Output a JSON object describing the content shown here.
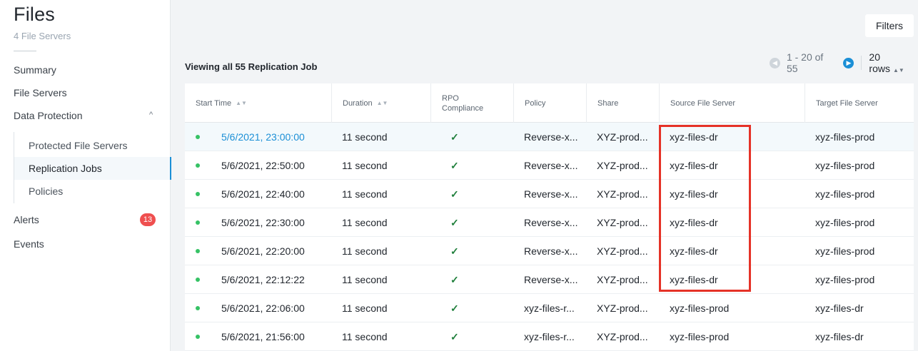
{
  "sidebar": {
    "title": "Files",
    "subtitle": "4 File Servers",
    "items": {
      "summary": "Summary",
      "file_servers": "File Servers",
      "data_protection": "Data Protection",
      "protected_file_servers": "Protected File Servers",
      "replication_jobs": "Replication Jobs",
      "policies": "Policies",
      "alerts": "Alerts",
      "alerts_count": "13",
      "events": "Events"
    }
  },
  "toolbar": {
    "filters_label": "Filters"
  },
  "list": {
    "viewing_text": "Viewing all 55 Replication Job"
  },
  "pagination": {
    "range": "1 - 20 of 55",
    "rows": "20 rows"
  },
  "columns": {
    "start_time": "Start Time",
    "duration": "Duration",
    "rpo_line1": "RPO",
    "rpo_line2": "Compliance",
    "policy": "Policy",
    "share": "Share",
    "source": "Source File Server",
    "target": "Target File Server"
  },
  "rows": [
    {
      "start": "5/6/2021, 23:00:00",
      "duration": "11 second",
      "rpo": "✓",
      "policy": "Reverse-x...",
      "share": "XYZ-prod...",
      "source": "xyz-files-dr",
      "target": "xyz-files-prod"
    },
    {
      "start": "5/6/2021, 22:50:00",
      "duration": "11 second",
      "rpo": "✓",
      "policy": "Reverse-x...",
      "share": "XYZ-prod...",
      "source": "xyz-files-dr",
      "target": "xyz-files-prod"
    },
    {
      "start": "5/6/2021, 22:40:00",
      "duration": "11 second",
      "rpo": "✓",
      "policy": "Reverse-x...",
      "share": "XYZ-prod...",
      "source": "xyz-files-dr",
      "target": "xyz-files-prod"
    },
    {
      "start": "5/6/2021, 22:30:00",
      "duration": "11 second",
      "rpo": "✓",
      "policy": "Reverse-x...",
      "share": "XYZ-prod...",
      "source": "xyz-files-dr",
      "target": "xyz-files-prod"
    },
    {
      "start": "5/6/2021, 22:20:00",
      "duration": "11 second",
      "rpo": "✓",
      "policy": "Reverse-x...",
      "share": "XYZ-prod...",
      "source": "xyz-files-dr",
      "target": "xyz-files-prod"
    },
    {
      "start": "5/6/2021, 22:12:22",
      "duration": "11 second",
      "rpo": "✓",
      "policy": "Reverse-x...",
      "share": "XYZ-prod...",
      "source": "xyz-files-dr",
      "target": "xyz-files-prod"
    },
    {
      "start": "5/6/2021, 22:06:00",
      "duration": "11 second",
      "rpo": "✓",
      "policy": "xyz-files-r...",
      "share": "XYZ-prod...",
      "source": "xyz-files-prod",
      "target": "xyz-files-dr"
    },
    {
      "start": "5/6/2021, 21:56:00",
      "duration": "11 second",
      "rpo": "✓",
      "policy": "xyz-files-r...",
      "share": "XYZ-prod...",
      "source": "xyz-files-prod",
      "target": "xyz-files-dr"
    }
  ],
  "colors": {
    "accent": "#1b8fd6",
    "status_ok": "#36c265",
    "badge": "#ef4f4f",
    "annotation": "#e53227"
  }
}
